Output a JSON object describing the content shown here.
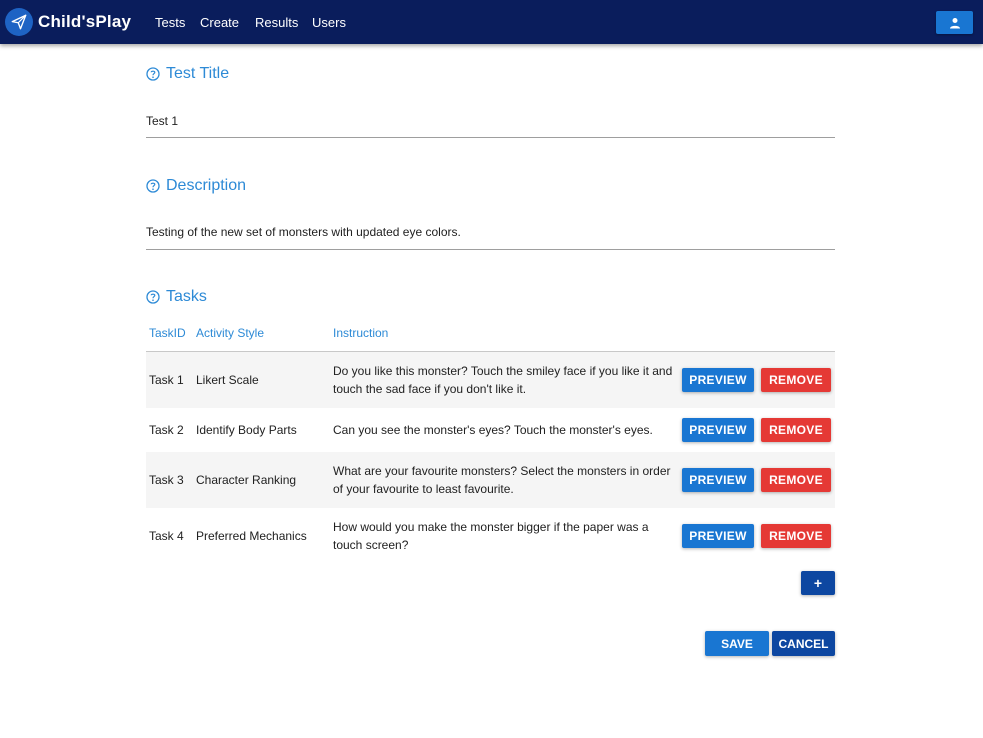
{
  "app": {
    "name": "Child'sPlay"
  },
  "nav": {
    "tests": "Tests",
    "create": "Create",
    "results": "Results",
    "users": "Users",
    "user_icon": "user-icon"
  },
  "title_section": {
    "label": "Test Title",
    "value": "Test 1",
    "icon": "help-circle-icon"
  },
  "description_section": {
    "label": "Description",
    "value": "Testing of the new set of monsters with updated eye colors.",
    "icon": "help-circle-icon"
  },
  "tasks_section": {
    "label": "Tasks",
    "icon": "help-circle-icon",
    "columns": {
      "task_id": "TaskID",
      "activity_style": "Activity Style",
      "instruction": "Instruction"
    },
    "rows": [
      {
        "id": "Task 1",
        "style": "Likert Scale",
        "instruction_line1": "Do you like this monster? Touch the smiley face if you like it and",
        "instruction_line2": "touch the sad face if you don't like it.",
        "preview": "PREVIEW",
        "remove": "REMOVE"
      },
      {
        "id": "Task 2",
        "style": "Identify Body Parts",
        "instruction_line1": "Can you see the monster's eyes? Touch the monster's eyes.",
        "instruction_line2": "",
        "preview": "PREVIEW",
        "remove": "REMOVE"
      },
      {
        "id": "Task 3",
        "style": "Character Ranking",
        "instruction_line1": "What are your favourite monsters? Select the monsters in order",
        "instruction_line2": "of your favourite to least favourite.",
        "preview": "PREVIEW",
        "remove": "REMOVE"
      },
      {
        "id": "Task 4",
        "style": "Preferred Mechanics",
        "instruction_line1": "How would you make the monster bigger if the paper was a",
        "instruction_line2": "touch screen?",
        "preview": "PREVIEW",
        "remove": "REMOVE"
      }
    ],
    "add_label": "+"
  },
  "actions": {
    "save": "SAVE",
    "cancel": "CANCEL"
  },
  "colors": {
    "navbar": "#0a1d5c",
    "accent": "#2d8ad6",
    "primary": "#1976d2",
    "danger": "#e53935",
    "dark_primary": "#0d47a1"
  }
}
